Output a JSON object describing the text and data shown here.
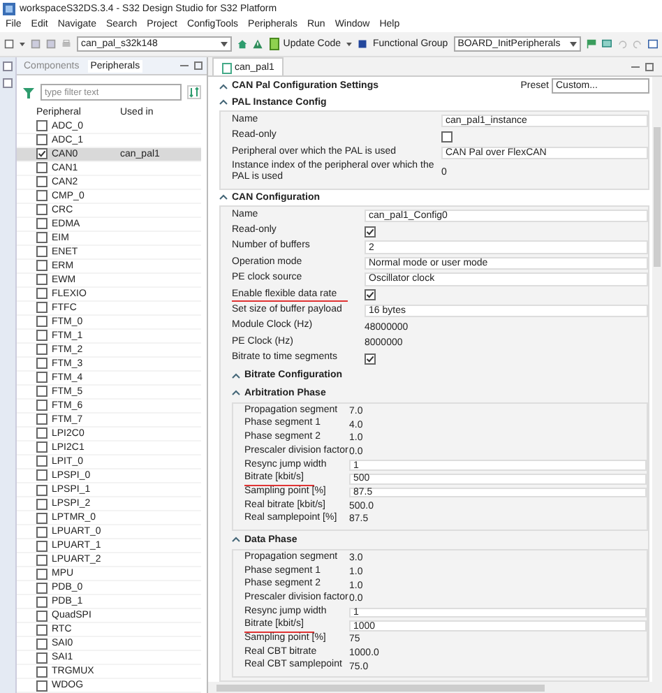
{
  "window": {
    "title": "workspaceS32DS.3.4 - S32 Design Studio for S32 Platform"
  },
  "menu": [
    "File",
    "Edit",
    "Navigate",
    "Search",
    "Project",
    "ConfigTools",
    "Peripherals",
    "Run",
    "Window",
    "Help"
  ],
  "toolbar": {
    "project": "can_pal_s32k148",
    "update_code": "Update Code",
    "functional_group_label": "Functional Group",
    "functional_group": "BOARD_InitPeripherals"
  },
  "left_panel": {
    "tabs": [
      {
        "label": "Components",
        "selected": false
      },
      {
        "label": "Peripherals",
        "selected": true
      }
    ],
    "filter": {
      "placeholder": "type filter text"
    },
    "columns": [
      "Peripheral",
      "Used in"
    ],
    "rows": [
      {
        "name": "ADC_0",
        "checked": false,
        "selected": false
      },
      {
        "name": "ADC_1",
        "checked": false,
        "selected": false
      },
      {
        "name": "CAN0",
        "used_in": "can_pal1",
        "checked": true,
        "selected": true
      },
      {
        "name": "CAN1",
        "checked": false,
        "selected": false
      },
      {
        "name": "CAN2",
        "checked": false,
        "selected": false
      },
      {
        "name": "CMP_0",
        "checked": false,
        "selected": false
      },
      {
        "name": "CRC",
        "checked": false,
        "selected": false
      },
      {
        "name": "EDMA",
        "checked": false,
        "selected": false
      },
      {
        "name": "EIM",
        "checked": false,
        "selected": false
      },
      {
        "name": "ENET",
        "checked": false,
        "selected": false
      },
      {
        "name": "ERM",
        "checked": false,
        "selected": false
      },
      {
        "name": "EWM",
        "checked": false,
        "selected": false
      },
      {
        "name": "FLEXIO",
        "checked": false,
        "selected": false
      },
      {
        "name": "FTFC",
        "checked": false,
        "selected": false
      },
      {
        "name": "FTM_0",
        "checked": false,
        "selected": false
      },
      {
        "name": "FTM_1",
        "checked": false,
        "selected": false
      },
      {
        "name": "FTM_2",
        "checked": false,
        "selected": false
      },
      {
        "name": "FTM_3",
        "checked": false,
        "selected": false
      },
      {
        "name": "FTM_4",
        "checked": false,
        "selected": false
      },
      {
        "name": "FTM_5",
        "checked": false,
        "selected": false
      },
      {
        "name": "FTM_6",
        "checked": false,
        "selected": false
      },
      {
        "name": "FTM_7",
        "checked": false,
        "selected": false
      },
      {
        "name": "LPI2C0",
        "checked": false,
        "selected": false
      },
      {
        "name": "LPI2C1",
        "checked": false,
        "selected": false
      },
      {
        "name": "LPIT_0",
        "checked": false,
        "selected": false
      },
      {
        "name": "LPSPI_0",
        "checked": false,
        "selected": false
      },
      {
        "name": "LPSPI_1",
        "checked": false,
        "selected": false
      },
      {
        "name": "LPSPI_2",
        "checked": false,
        "selected": false
      },
      {
        "name": "LPTMR_0",
        "checked": false,
        "selected": false
      },
      {
        "name": "LPUART_0",
        "checked": false,
        "selected": false
      },
      {
        "name": "LPUART_1",
        "checked": false,
        "selected": false
      },
      {
        "name": "LPUART_2",
        "checked": false,
        "selected": false
      },
      {
        "name": "MPU",
        "checked": false,
        "selected": false
      },
      {
        "name": "PDB_0",
        "checked": false,
        "selected": false
      },
      {
        "name": "PDB_1",
        "checked": false,
        "selected": false
      },
      {
        "name": "QuadSPI",
        "checked": false,
        "selected": false
      },
      {
        "name": "RTC",
        "checked": false,
        "selected": false
      },
      {
        "name": "SAI0",
        "checked": false,
        "selected": false
      },
      {
        "name": "SAI1",
        "checked": false,
        "selected": false
      },
      {
        "name": "TRGMUX",
        "checked": false,
        "selected": false
      },
      {
        "name": "WDOG",
        "checked": false,
        "selected": false
      }
    ]
  },
  "editor": {
    "tab": "can_pal1",
    "title": "CAN Pal Configuration Settings",
    "preset_label": "Preset",
    "preset": "Custom...",
    "sections": [
      {
        "title": "PAL Instance Config",
        "rows": [
          {
            "kind": "field",
            "label": "Name",
            "value": "can_pal1_instance",
            "highlighted": false
          },
          {
            "kind": "check",
            "label": "Read-only",
            "checked": false,
            "highlighted": false
          },
          {
            "kind": "field",
            "label": "Peripheral over which the PAL is used",
            "value": "CAN Pal over FlexCAN",
            "highlighted": false
          },
          {
            "kind": "plain",
            "label": "Instance index of the peripheral over which the PAL is used",
            "value": "0",
            "highlighted": false
          }
        ]
      },
      {
        "title": "CAN Configuration",
        "rows": [
          {
            "kind": "field",
            "label": "Name",
            "value": "can_pal1_Config0",
            "highlighted": false
          },
          {
            "kind": "check",
            "label": "Read-only",
            "checked": true,
            "highlighted": false
          },
          {
            "kind": "field",
            "label": "Number of buffers",
            "value": "2",
            "highlighted": false
          },
          {
            "kind": "field",
            "label": "Operation mode",
            "value": "Normal mode or user mode",
            "highlighted": false
          },
          {
            "kind": "field",
            "label": "PE clock source",
            "value": "Oscillator clock",
            "highlighted": false
          },
          {
            "kind": "check",
            "label": "Enable flexible data rate",
            "checked": true,
            "highlighted": true
          },
          {
            "kind": "field",
            "label": "Set size of buffer payload",
            "value": "16 bytes",
            "highlighted": false
          },
          {
            "kind": "plain",
            "label": "Module Clock (Hz)",
            "value": "48000000",
            "highlighted": false
          },
          {
            "kind": "plain",
            "label": "PE Clock (Hz)",
            "value": "8000000",
            "highlighted": false
          },
          {
            "kind": "check",
            "label": "Bitrate to time segments",
            "checked": true,
            "highlighted": false
          }
        ],
        "subsection": {
          "title": "Bitrate Configuration",
          "groups": [
            {
              "title": "Arbitration Phase",
              "rows": [
                {
                  "kind": "plain",
                  "label": "Propagation segment",
                  "value": "7.0",
                  "highlighted": false
                },
                {
                  "kind": "plain",
                  "label": "Phase segment 1",
                  "value": "4.0",
                  "highlighted": false
                },
                {
                  "kind": "plain",
                  "label": "Phase segment 2",
                  "value": "1.0",
                  "highlighted": false
                },
                {
                  "kind": "plain",
                  "label": "Prescaler division factor",
                  "value": "0.0",
                  "highlighted": false
                },
                {
                  "kind": "field",
                  "label": "Resync jump width",
                  "value": "1",
                  "highlighted": false
                },
                {
                  "kind": "field",
                  "label": "Bitrate [kbit/s]",
                  "value": "500",
                  "highlighted": true
                },
                {
                  "kind": "field",
                  "label": "Sampling point [%]",
                  "value": "87.5",
                  "highlighted": false
                },
                {
                  "kind": "plain",
                  "label": "Real bitrate [kbit/s]",
                  "value": "500.0",
                  "highlighted": false
                },
                {
                  "kind": "plain",
                  "label": "Real samplepoint [%]",
                  "value": "87.5",
                  "highlighted": false
                }
              ]
            },
            {
              "title": "Data Phase",
              "rows": [
                {
                  "kind": "plain",
                  "label": "Propagation segment",
                  "value": "3.0",
                  "highlighted": false
                },
                {
                  "kind": "plain",
                  "label": "Phase segment 1",
                  "value": "1.0",
                  "highlighted": false
                },
                {
                  "kind": "plain",
                  "label": "Phase segment 2",
                  "value": "1.0",
                  "highlighted": false
                },
                {
                  "kind": "plain",
                  "label": "Prescaler division factor",
                  "value": "0.0",
                  "highlighted": false
                },
                {
                  "kind": "field",
                  "label": "Resync jump width",
                  "value": "1",
                  "highlighted": false
                },
                {
                  "kind": "field",
                  "label": "Bitrate [kbit/s]",
                  "value": "1000",
                  "highlighted": true
                },
                {
                  "kind": "plain",
                  "label": "Sampling point [%]",
                  "value": "75",
                  "highlighted": false
                },
                {
                  "kind": "plain",
                  "label": "Real CBT bitrate",
                  "value": "1000.0",
                  "highlighted": false
                },
                {
                  "kind": "plain",
                  "label": "Real CBT samplepoint",
                  "value": "75.0",
                  "highlighted": false
                }
              ]
            }
          ]
        }
      }
    ]
  }
}
